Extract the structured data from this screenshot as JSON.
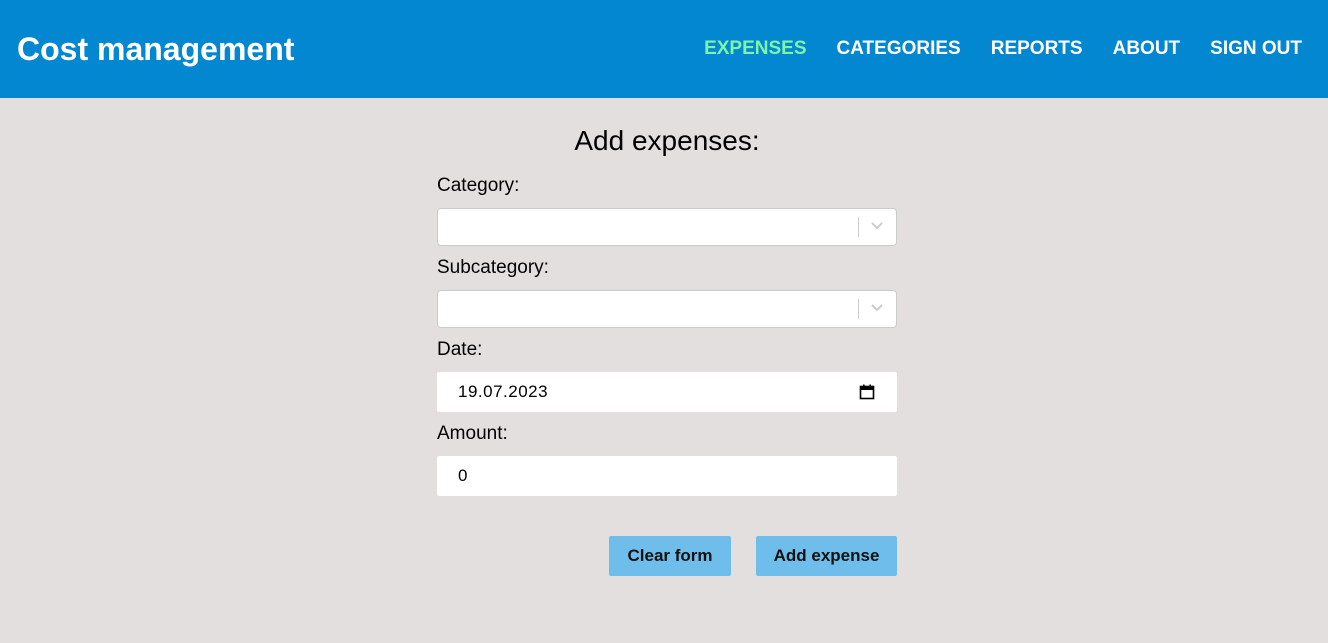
{
  "header": {
    "title": "Cost management",
    "nav": [
      {
        "label": "EXPENSES",
        "active": true
      },
      {
        "label": "CATEGORIES",
        "active": false
      },
      {
        "label": "REPORTS",
        "active": false
      },
      {
        "label": "ABOUT",
        "active": false
      },
      {
        "label": "SIGN OUT",
        "active": false
      }
    ]
  },
  "page": {
    "title": "Add expenses:"
  },
  "form": {
    "category_label": "Category:",
    "category_value": "",
    "subcategory_label": "Subcategory:",
    "subcategory_value": "",
    "date_label": "Date:",
    "date_value": "19.07.2023",
    "amount_label": "Amount:",
    "amount_value": "0",
    "clear_button": "Clear form",
    "add_button": "Add expense"
  },
  "colors": {
    "header_bg": "#0387d0",
    "active_nav": "#7cf5a8",
    "page_bg": "#e3dfdf",
    "button_bg": "#6fbdea"
  },
  "icons": {
    "select_arrow": "chevron-down-icon",
    "date_picker": "calendar-icon"
  }
}
